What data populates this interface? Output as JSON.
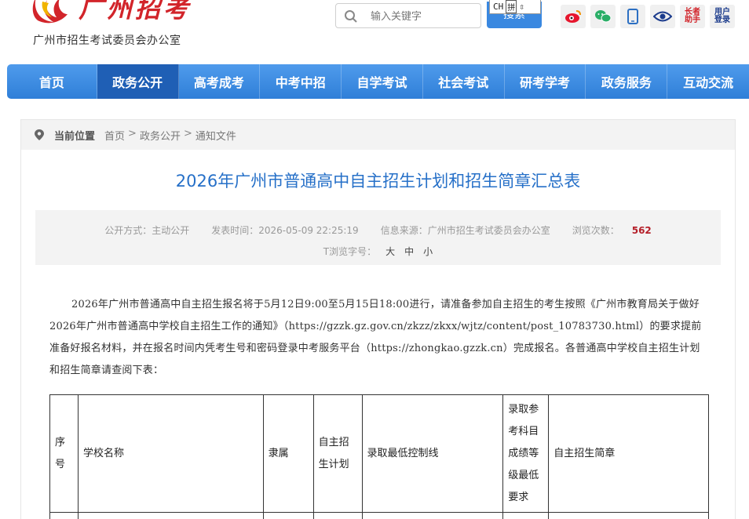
{
  "header": {
    "logo_calligraphy": "广州招考",
    "org_name": "广州市招生考试委员会办公室",
    "search": {
      "placeholder": "输入关键字",
      "button_label": "搜索"
    },
    "ime": {
      "lang": "CH",
      "mode": "拼"
    },
    "icons": [
      {
        "name": "weibo-icon"
      },
      {
        "name": "wechat-icon"
      },
      {
        "name": "mobile-icon"
      },
      {
        "name": "eye-icon"
      }
    ],
    "elder_helper": "长者助手",
    "user_login": "用户登录"
  },
  "nav": {
    "items": [
      "首页",
      "政务公开",
      "高考成考",
      "中考中招",
      "自学考试",
      "社会考试",
      "研考学考",
      "政务服务",
      "互动交流"
    ],
    "active_index": 1
  },
  "breadcrumb": {
    "label": "当前位置",
    "path": [
      "首页",
      "政务公开",
      "通知文件"
    ],
    "separator": ">"
  },
  "article": {
    "title": "2026年广州市普通高中自主招生计划和招生简章汇总表",
    "meta": {
      "disclosure": "公开方式：主动公开",
      "published": "发表时间：2026-05-09 22:25:19",
      "source": "信息来源：广州市招生考试委员会办公室",
      "views_label": "浏览次数：",
      "views_count": "562",
      "font_size_label": "T浏览字号：",
      "font_sizes": [
        "大",
        "中",
        "小"
      ]
    },
    "body": "2026年广州市普通高中自主招生报名将于5月12日9:00至5月15日18:00进行，请准备参加自主招生的考生按照《广州市教育局关于做好2026年广州市普通高中学校自主招生工作的通知》（https://gzzk.gz.gov.cn/zkzz/zkxx/wjtz/content/post_10783730.html）的要求提前准备好报名材料，并在报名时间内凭考生号和密码登录中考服务平台（https://zhongkao.gzzk.cn）完成报名。各普通高中学校自主招生计划和招生简章请查阅下表："
  },
  "table": {
    "headers": {
      "seq": "序号",
      "school": "学校名称",
      "affiliation": "隶属",
      "plan": "自主招生计划",
      "min_score": "录取最低控制线",
      "subject_req": "录取参考科目成绩等级最低要求",
      "brochure": "自主招生简章"
    }
  },
  "colors": {
    "brand_red": "#d2242a",
    "nav_blue": "#2f7fd8",
    "nav_active": "#1f5fb5",
    "title_blue": "#2670c8",
    "views_red": "#b5202a"
  }
}
